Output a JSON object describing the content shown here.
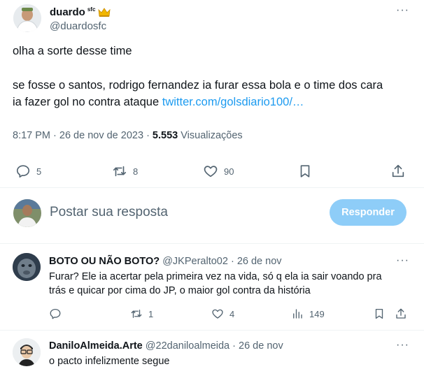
{
  "tweet": {
    "author_name": "duardo",
    "author_badge": "sfc",
    "author_handle": "@duardosfc",
    "line1": "olha a sorte desse time",
    "line2": "se fosse o santos, rodrigo fernandez ia furar essa bola e o time dos cara",
    "line3_prefix": "ia fazer gol no contra ataque ",
    "link": "twitter.com/golsdiario100/…",
    "time": "8:17 PM",
    "date": "26 de nov de 2023",
    "views_count": "5.553",
    "views_label": "Visualizações",
    "replies": "5",
    "retweets": "8",
    "likes": "90"
  },
  "reply_box": {
    "placeholder": "Postar sua resposta",
    "button": "Responder"
  },
  "replies": [
    {
      "name": "BOTO OU NÃO BOTO?",
      "handle": "@JKPeralto02",
      "date": "26 de nov",
      "line1": "Furar? Ele ia acertar pela primeira vez na vida, só q ela ia sair voando pra",
      "line2": "trás e quicar por cima do JP, o maior gol contra da história",
      "replies": "",
      "retweets": "1",
      "likes": "4",
      "views": "149"
    },
    {
      "name": "DaniloAlmeida.Arte",
      "handle": "@22daniloalmeida",
      "date": "26 de nov",
      "line1": "o pacto infelizmente segue"
    }
  ],
  "colors": {
    "link": "#1d9bf0",
    "muted": "#536471",
    "button": "#8ecdf8"
  }
}
